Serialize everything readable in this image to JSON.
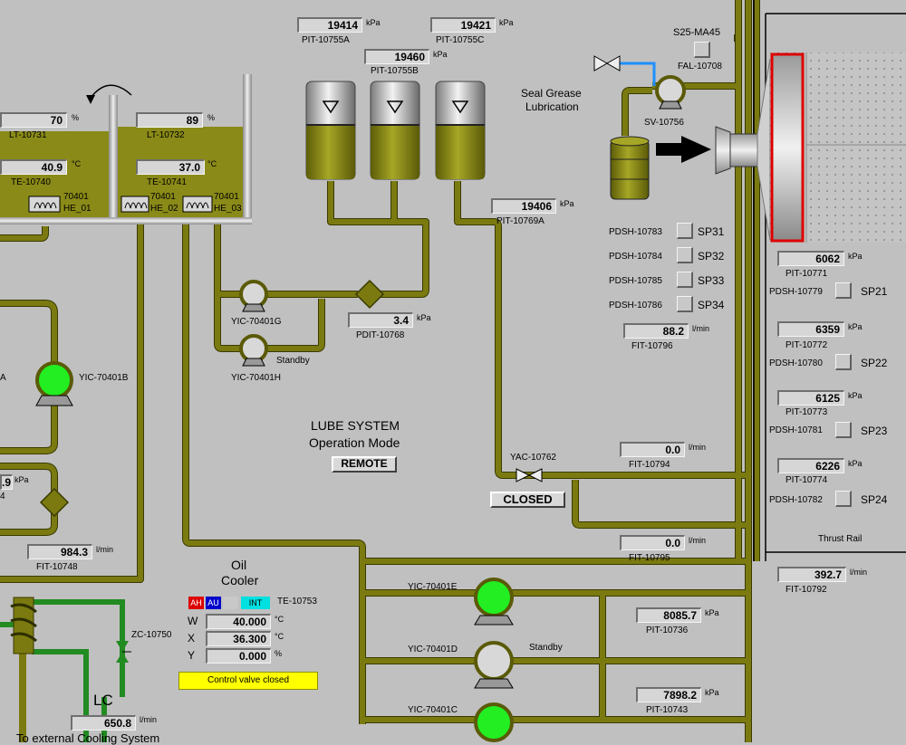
{
  "colors": {
    "pipe": "#7a7a10",
    "oil": "#8a8a18",
    "background": "#c0c0c0",
    "pump_running": "#22ee22",
    "pump_idle": "#d8d8d8",
    "filter_border": "#dd0000",
    "banner": "#ffff00",
    "alarm_ah": "#dd0000",
    "alarm_au": "#0000cc",
    "int_flag": "#00e0e0"
  },
  "icons": {
    "fan_arrow": "curved-arrow-icon",
    "heater": "heater-coil-icon",
    "pump": "pump-icon",
    "valve": "bowtie-valve-icon",
    "filter": "diamond-filter-icon",
    "direction": "black-arrow-icon"
  },
  "tank": {
    "lt1": {
      "value": "70",
      "unit": "%",
      "tag": "LT-10731"
    },
    "lt2": {
      "value": "89",
      "unit": "%",
      "tag": "LT-10732"
    },
    "te1": {
      "value": "40.9",
      "unit": "°C",
      "tag": "TE-10740"
    },
    "te2": {
      "value": "37.0",
      "unit": "°C",
      "tag": "TE-10741"
    },
    "he1": {
      "tag1": "70401",
      "tag2": "HE_01"
    },
    "he2": {
      "tag1": "70401",
      "tag2": "HE_02"
    },
    "he3": {
      "tag1": "70401",
      "tag2": "HE_03"
    }
  },
  "accumulators": {
    "pit_a": {
      "value": "19414",
      "unit": "kPa",
      "tag": "PIT-10755A"
    },
    "pit_b": {
      "value": "19460",
      "unit": "kPa",
      "tag": "PIT-10755B"
    },
    "pit_c": {
      "value": "19421",
      "unit": "kPa",
      "tag": "PIT-10755C"
    },
    "pit_769a": {
      "value": "19406",
      "unit": "kPa",
      "tag": "PIT-10769A"
    }
  },
  "seal": {
    "s25": "S25-MA45",
    "fal": "FAL-10708",
    "title_line1": "Seal Grease",
    "title_line2": "Lubrication",
    "sv": "SV-10756"
  },
  "pumps_top": {
    "g": "YIC-70401G",
    "h": "YIC-70401H",
    "standby": "Standby"
  },
  "pdit": {
    "value": "3.4",
    "unit": "kPa",
    "tag": "PDIT-10768"
  },
  "pdsh_left": [
    {
      "tag": "PDSH-10783",
      "sp": "SP31"
    },
    {
      "tag": "PDSH-10784",
      "sp": "SP32"
    },
    {
      "tag": "PDSH-10785",
      "sp": "SP33"
    },
    {
      "tag": "PDSH-10786",
      "sp": "SP34"
    }
  ],
  "fit_796": {
    "value": "88.2",
    "unit": "l/min",
    "tag": "FIT-10796"
  },
  "right_panel": [
    {
      "pit_value": "6062",
      "pit_unit": "kPa",
      "pit_tag": "PIT-10771",
      "pdsh": "PDSH-10779",
      "sp": "SP21"
    },
    {
      "pit_value": "6359",
      "pit_unit": "kPa",
      "pit_tag": "PIT-10772",
      "pdsh": "PDSH-10780",
      "sp": "SP22"
    },
    {
      "pit_value": "6125",
      "pit_unit": "kPa",
      "pit_tag": "PIT-10773",
      "pdsh": "PDSH-10781",
      "sp": "SP23"
    },
    {
      "pit_value": "6226",
      "pit_unit": "kPa",
      "pit_tag": "PIT-10774",
      "pdsh": "PDSH-10782",
      "sp": "SP24"
    }
  ],
  "thrust_rail": "Thrust Rail",
  "fit_792": {
    "value": "392.7",
    "unit": "l/min",
    "tag": "FIT-10792"
  },
  "lube": {
    "title": "LUBE SYSTEM",
    "subtitle": "Operation Mode",
    "mode": "REMOTE"
  },
  "yac": {
    "tag": "YAC-10762",
    "state": "CLOSED"
  },
  "fit_794": {
    "value": "0.0",
    "unit": "l/min",
    "tag": "FIT-10794"
  },
  "fit_795": {
    "value": "0.0",
    "unit": "l/min",
    "tag": "FIT-10795"
  },
  "left": {
    "pump_b": "YIC-70401B",
    "a_frag": "A",
    "kpa_value": ".9",
    "kpa_unit": "kPa",
    "kpa_frag": "4",
    "fit_748": {
      "value": "984.3",
      "unit": "l/min",
      "tag": "FIT-10748"
    }
  },
  "cooler": {
    "title_line1": "Oil",
    "title_line2": "Cooler",
    "ah": "AH",
    "au": "AU",
    "int": "INT",
    "te": "TE-10753",
    "w_label": "W",
    "w_value": "40.000",
    "w_unit": "°C",
    "x_label": "X",
    "x_value": "36.300",
    "x_unit": "°C",
    "y_label": "Y",
    "y_value": "0.000",
    "y_unit": "%",
    "banner": "Control valve closed",
    "zc": "ZC-10750",
    "lc": "LC",
    "fit_value": "650.8",
    "fit_unit": "l/min",
    "footer": "To external Cooling System"
  },
  "pumps_bottom": {
    "e": "YIC-70401E",
    "d": "YIC-70401D",
    "c": "YIC-70401C",
    "standby": "Standby"
  },
  "pit_736": {
    "value": "8085.7",
    "unit": "kPa",
    "tag": "PIT-10736"
  },
  "pit_743": {
    "value": "7898.2",
    "unit": "kPa",
    "tag": "PIT-10743"
  }
}
